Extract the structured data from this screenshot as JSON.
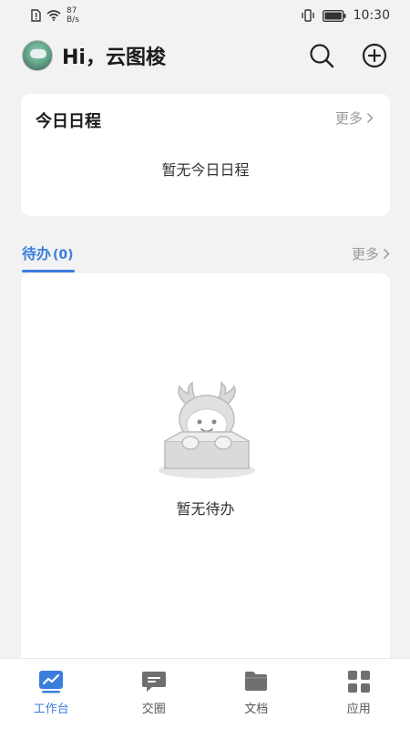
{
  "status_bar": {
    "speed_value": "87",
    "speed_unit": "B/s",
    "time": "10:30"
  },
  "header": {
    "greeting": "Hi，云图梭",
    "icons": [
      "search-icon",
      "add-circle-icon"
    ]
  },
  "schedule": {
    "title": "今日日程",
    "more_label": "更多",
    "empty_text": "暂无今日日程"
  },
  "todo": {
    "tab_label": "待办",
    "count": "(0)",
    "more_label": "更多",
    "empty_text": "暂无待办"
  },
  "bottom_nav": {
    "items": [
      {
        "label": "工作台",
        "icon": "workbench-chart-icon",
        "active": true
      },
      {
        "label": "交圈",
        "icon": "chat-bubble-icon",
        "active": false
      },
      {
        "label": "文档",
        "icon": "folder-icon",
        "active": false
      },
      {
        "label": "应用",
        "icon": "apps-grid-icon",
        "active": false
      }
    ]
  },
  "colors": {
    "accent": "#3b7ddd",
    "background": "#f2f2f2",
    "muted_text": "#999999"
  }
}
